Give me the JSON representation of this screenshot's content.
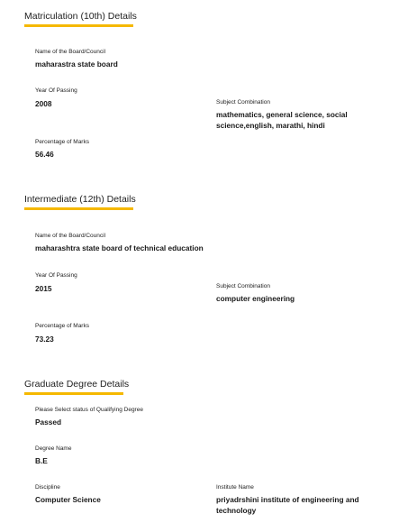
{
  "matriculation": {
    "title": "Matriculation (10th) Details",
    "board_label": "Name of the Board/Council",
    "board_value": "maharastra state board",
    "year_label": "Year Of Passing",
    "year_value": "2008",
    "subject_label": "Subject Combination",
    "subject_value": "mathematics, general science, social science,english, marathi, hindi",
    "percentage_label": "Percentage of Marks",
    "percentage_value": "56.46"
  },
  "intermediate": {
    "title": "Intermediate (12th) Details",
    "board_label": "Name of the Board/Council",
    "board_value": "maharashtra state board of technical education",
    "year_label": "Year Of Passing",
    "year_value": "2015",
    "subject_label": "Subject Combination",
    "subject_value": "computer engineering",
    "percentage_label": "Percentage of Marks",
    "percentage_value": "73.23"
  },
  "graduate": {
    "title": "Graduate Degree Details",
    "status_label": "Please Select status of Qualifying Degree",
    "status_value": "Passed",
    "degree_label": "Degree Name",
    "degree_value": "B.E",
    "discipline_label": "Discipline",
    "discipline_value": "Computer Science",
    "institute_label": "Institute Name",
    "institute_value": "priyadrshini institute of engineering and technology"
  },
  "colors": {
    "accent_underline": "#f5b800"
  }
}
